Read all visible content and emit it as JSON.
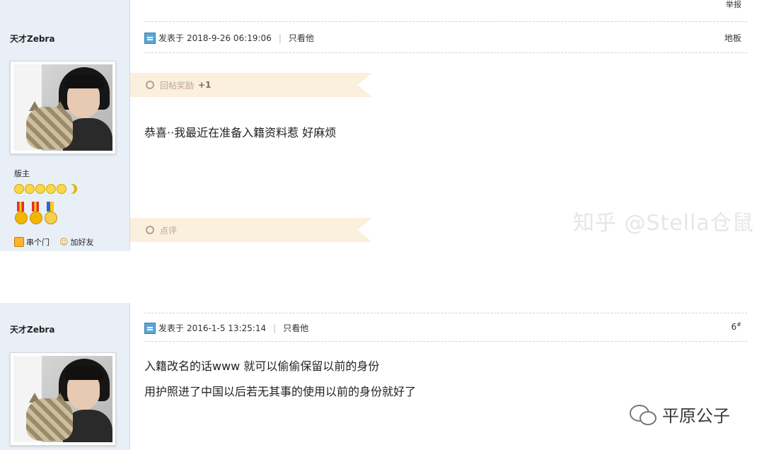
{
  "posts": [
    {
      "username": "天才Zebra",
      "report_label": "举报",
      "meta": {
        "posted_prefix": "发表于",
        "datetime": "2018-9-26 06:19:06",
        "only_him": "只看他"
      },
      "floor": "地板",
      "reward": {
        "label": "回帖奖励",
        "value": "+1"
      },
      "content": [
        "恭喜··我最近在准备入籍资料惹 好麻烦"
      ],
      "comment_label": "点评",
      "role": "版主",
      "links": [
        "串个门",
        "加好友"
      ]
    },
    {
      "username": "天才Zebra",
      "meta": {
        "posted_prefix": "发表于",
        "datetime": "2016-1-5 13:25:14",
        "only_him": "只看他"
      },
      "floor": "6",
      "floor_suffix": "#",
      "content": [
        "入籍改名的话www 就可以偷偷保留以前的身份",
        "用护照进了中国以后若无其事的使用以前的身份就好了"
      ]
    }
  ],
  "watermark": "知乎 @Stella仓鼠",
  "wechat_name": "平原公子",
  "icons": {
    "post": "post-icon",
    "circle": "circle-icon",
    "home": "home-icon",
    "friend": "add-friend-icon",
    "wechat": "wechat-logo-icon"
  },
  "colors": {
    "sidebar_bg": "#e9eff7",
    "ribbon_bg": "#fbefdd",
    "icon_blue": "#5aa7d8"
  }
}
